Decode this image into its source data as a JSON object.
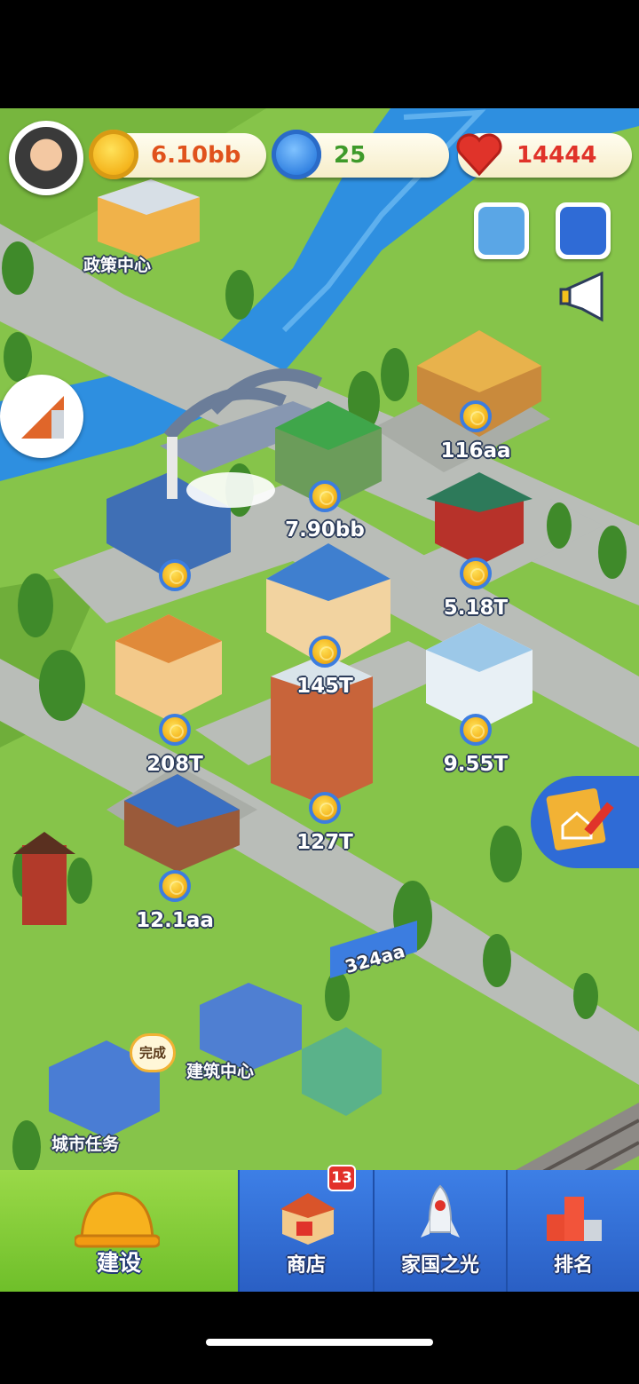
{
  "resources": {
    "coins": "6.10bb",
    "stars": "25",
    "hearts": "14444"
  },
  "places": {
    "policy_center": "政策中心",
    "building_center": "建筑中心",
    "city_tasks": "城市任务",
    "complete_tag": "完成",
    "billboard": "324aa"
  },
  "buildings": [
    {
      "income": "116aa"
    },
    {
      "income": "7.90bb"
    },
    {
      "income": "5.18T"
    },
    {
      "income": "145T"
    },
    {
      "income": "208T"
    },
    {
      "income": "9.55T"
    },
    {
      "income": "127T"
    },
    {
      "income": "12.1aa"
    }
  ],
  "nav": {
    "build": "建设",
    "shop": "商店",
    "shop_badge": "13",
    "homeland": "家国之光",
    "ranking": "排名"
  },
  "colors": {
    "grass": "#86c44a",
    "road": "#b9bdb8",
    "river": "#2e8fe0",
    "nav_active": "#7cc630",
    "nav_inactive": "#2f6bd6",
    "coin_text": "#e0521c",
    "star_text": "#3e9a2a",
    "heart_text": "#e0332a"
  },
  "icons": [
    "gold-coin-icon",
    "blue-star-icon",
    "red-heart-icon",
    "megaphone-icon",
    "hard-hat-icon",
    "shop-icon",
    "rocket-icon",
    "ranking-podium-icon",
    "blueprint-icon",
    "triangle-ruler-icon"
  ]
}
